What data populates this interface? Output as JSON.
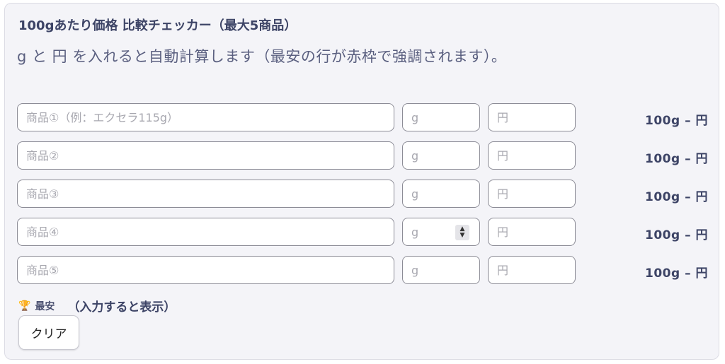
{
  "title": "100gあたり価格 比較チェッカー（最大5商品）",
  "description": "g と 円 を入れると自動計算します（最安の行が赤枠で強調されます）。",
  "rows": [
    {
      "name_placeholder": "商品①（例：エクセラ115g）",
      "gram_placeholder": "g",
      "yen_placeholder": "円",
      "result": "100g – 円"
    },
    {
      "name_placeholder": "商品②",
      "gram_placeholder": "g",
      "yen_placeholder": "円",
      "result": "100g – 円"
    },
    {
      "name_placeholder": "商品③",
      "gram_placeholder": "g",
      "yen_placeholder": "円",
      "result": "100g – 円"
    },
    {
      "name_placeholder": "商品④",
      "gram_placeholder": "g",
      "yen_placeholder": "円",
      "result": "100g – 円"
    },
    {
      "name_placeholder": "商品⑤",
      "gram_placeholder": "g",
      "yen_placeholder": "円",
      "result": "100g – 円"
    }
  ],
  "best": {
    "icon": "trophy-icon",
    "label": "最安",
    "hint": "（入力すると表示）"
  },
  "clear_label": "クリア",
  "colors": {
    "panel_bg": "#f4f4f8",
    "text": "#3d4466",
    "trophy": "#d9a31a"
  }
}
